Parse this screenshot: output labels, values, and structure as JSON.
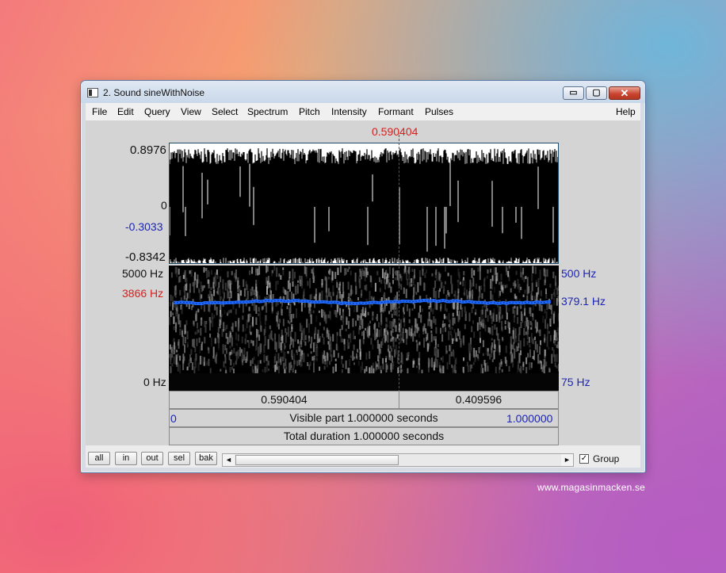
{
  "window": {
    "title": "2. Sound sineWithNoise",
    "min_label": "▭",
    "max_label": "▢",
    "close_label": "✕"
  },
  "menu": {
    "items": [
      "File",
      "Edit",
      "Query",
      "View",
      "Select",
      "Spectrum",
      "Pitch",
      "Intensity",
      "Formant",
      "Pulses"
    ],
    "help": "Help"
  },
  "cursor_time": "0.590404",
  "waveform": {
    "max_label": "0.8976",
    "zero_label": "0",
    "cursor_value": "-0.3033",
    "min_label": "-0.8342"
  },
  "spectrogram": {
    "top_freq": "5000 Hz",
    "cursor_freq": "3866 Hz",
    "bottom_freq": "0 Hz"
  },
  "pitch": {
    "top": "500 Hz",
    "current": "379.1 Hz",
    "bottom": "75 Hz"
  },
  "timebar": {
    "left_segment": "0.590404",
    "right_segment": "0.409596",
    "visible_start": "0",
    "visible_label": "Visible part 1.000000 seconds",
    "visible_end": "1.000000",
    "total_label": "Total duration 1.000000 seconds"
  },
  "buttons": {
    "all": "all",
    "in": "in",
    "out": "out",
    "sel": "sel",
    "bak": "bak"
  },
  "scroll": {
    "left": "◄",
    "right": "►"
  },
  "group": {
    "label": "Group",
    "checked": "✓"
  },
  "watermark": "www.magasinmacken.se",
  "colors": {
    "cursor": "#d4211f",
    "pitch_line": "#1f6bff",
    "axis_blue": "#1b24b8"
  }
}
